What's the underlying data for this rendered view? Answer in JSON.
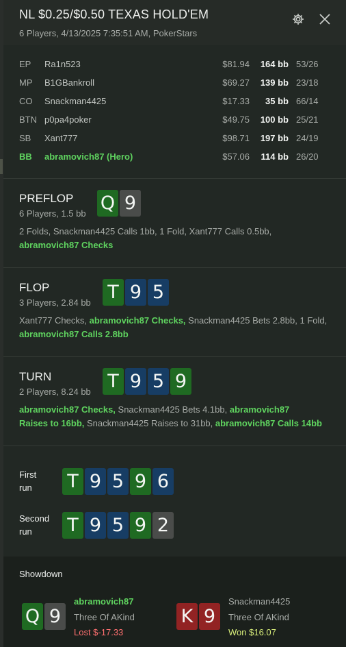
{
  "header": {
    "title": "NL $0.25/$0.50 TEXAS HOLD'EM",
    "subtitle": "6 Players, 4/13/2025 7:35:51 AM, PokerStars"
  },
  "players": [
    {
      "pos": "EP",
      "name": "Ra1n523",
      "stack": "$81.94",
      "bb": "164 bb",
      "stats": "53/26"
    },
    {
      "pos": "MP",
      "name": "B1GBankroll",
      "stack": "$69.27",
      "bb": "139 bb",
      "stats": "23/18"
    },
    {
      "pos": "CO",
      "name": "Snackman4425",
      "stack": "$17.33",
      "bb": "35 bb",
      "stats": "66/14"
    },
    {
      "pos": "BTN",
      "name": "p0pa4poker",
      "stack": "$49.75",
      "bb": "100 bb",
      "stats": "25/21"
    },
    {
      "pos": "SB",
      "name": "Xant777",
      "stack": "$98.71",
      "bb": "197 bb",
      "stats": "24/19"
    },
    {
      "pos": "BB",
      "name": "abramovich87 (Hero)",
      "stack": "$57.06",
      "bb": "114 bb",
      "stats": "26/20"
    }
  ],
  "preflop": {
    "name": "PREFLOP",
    "info": "6 Players, 1.5 bb",
    "cards": [
      {
        "rank": "Q",
        "suit": "clubs"
      },
      {
        "rank": "9",
        "suit": "spades"
      }
    ],
    "action_1": "2 Folds, Snackman4425 Calls 1bb, 1 Fold, Xant777 Calls 0.5bb,",
    "action_2": "abramovich87 Checks"
  },
  "flop": {
    "name": "FLOP",
    "info": "3 Players, 2.84 bb",
    "cards": [
      {
        "rank": "T",
        "suit": "clubs"
      },
      {
        "rank": "9",
        "suit": "diamonds"
      },
      {
        "rank": "5",
        "suit": "diamonds"
      }
    ],
    "action_1": "Xant777 Checks, ",
    "action_2": "abramovich87 Checks,",
    "action_3": " Snackman4425 Bets 2.8bb, 1 Fold,",
    "action_4": "abramovich87 Calls 2.8bb"
  },
  "turn": {
    "name": "TURN",
    "info": "2 Players, 8.24 bb",
    "cards": [
      {
        "rank": "T",
        "suit": "clubs"
      },
      {
        "rank": "9",
        "suit": "diamonds"
      },
      {
        "rank": "5",
        "suit": "diamonds"
      },
      {
        "rank": "9",
        "suit": "clubs"
      }
    ],
    "action_1": "abramovich87 Checks,",
    "action_2": " Snackman4425 Bets 4.1bb, ",
    "action_3": "abramovich87",
    "action_4": "Raises to 16bb,",
    "action_5": " Snackman4425 Raises to 31bb, ",
    "action_6": "abramovich87 Calls 14bb"
  },
  "runs": [
    {
      "label_1": "First",
      "label_2": "run",
      "cards": [
        {
          "rank": "T",
          "suit": "clubs"
        },
        {
          "rank": "9",
          "suit": "diamonds"
        },
        {
          "rank": "5",
          "suit": "diamonds"
        },
        {
          "rank": "9",
          "suit": "clubs"
        },
        {
          "rank": "6",
          "suit": "diamonds"
        }
      ]
    },
    {
      "label_1": "Second",
      "label_2": "run",
      "cards": [
        {
          "rank": "T",
          "suit": "clubs"
        },
        {
          "rank": "9",
          "suit": "diamonds"
        },
        {
          "rank": "5",
          "suit": "diamonds"
        },
        {
          "rank": "9",
          "suit": "clubs"
        },
        {
          "rank": "2",
          "suit": "spades"
        }
      ]
    }
  ],
  "showdown": {
    "title": "Showdown",
    "hands": [
      {
        "player": "abramovich87",
        "hand": "Three Of AKind",
        "result": "Lost $-17.33",
        "cards": [
          {
            "rank": "Q",
            "suit": "clubs"
          },
          {
            "rank": "9",
            "suit": "spades"
          }
        ]
      },
      {
        "player": "Snackman4425",
        "hand": "Three Of AKind",
        "result": "Won $16.07",
        "cards": [
          {
            "rank": "K",
            "suit": "hearts"
          },
          {
            "rank": "9",
            "suit": "hearts"
          }
        ]
      }
    ]
  },
  "icons": {
    "settings": "gear-icon",
    "close": "close-icon"
  },
  "colors": {
    "hero": "#5fd35f",
    "clubs": "#1f6a22",
    "diamonds": "#173d64",
    "spades": "#4a4c4a",
    "hearts": "#922323",
    "lost": "#ff7070",
    "won": "#d8ee7a"
  }
}
